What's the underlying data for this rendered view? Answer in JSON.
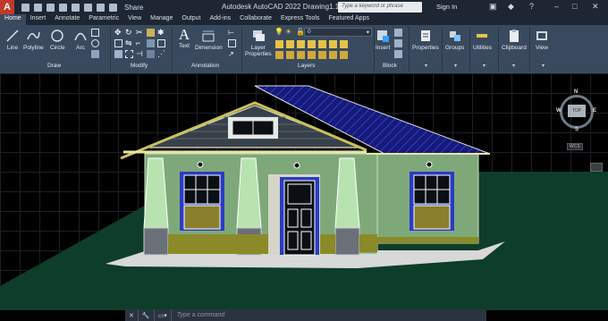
{
  "app": {
    "logo": "A",
    "share_label": "Share",
    "title": "Autodesk AutoCAD 2022    Drawing1.11.dwg",
    "search_placeholder": "Type a keyword or phrase",
    "signin_label": "Sign In"
  },
  "tabs": [
    "Home",
    "Insert",
    "Annotate",
    "Parametric",
    "View",
    "Manage",
    "Output",
    "Add-ins",
    "Collaborate",
    "Express Tools",
    "Featured Apps"
  ],
  "ribbon": {
    "draw": {
      "line": "Line",
      "polyline": "Polyline",
      "circle": "Circle",
      "arc": "Arc",
      "group": "Draw"
    },
    "modify": {
      "group": "Modify"
    },
    "annotation": {
      "text": "Text",
      "dimension": "Dimension",
      "group": "Annotation"
    },
    "layers": {
      "layer_properties": "Layer\nProperties",
      "current_layer": "0",
      "group": "Layers"
    },
    "block": {
      "insert": "Insert",
      "group": "Block"
    },
    "properties": "Properties",
    "groups": "Groups",
    "utilities": "Utilities",
    "clipboard": "Clipboard",
    "view": "View"
  },
  "viewcube": {
    "top": "TOP",
    "n": "N",
    "s": "S",
    "e": "E",
    "w": "W",
    "wcs": "WCS"
  },
  "command": {
    "placeholder": "Type a command"
  },
  "colors": {
    "ribbon_bg": "#3a4a5e",
    "titlebar_bg": "#1d2632",
    "canvas_bg": "#000000",
    "wall_green": "#7fa87a",
    "roof_blue": "#1c1f8a",
    "ground_green": "#0e3d2a",
    "trim_blue": "#2a3cc4"
  }
}
